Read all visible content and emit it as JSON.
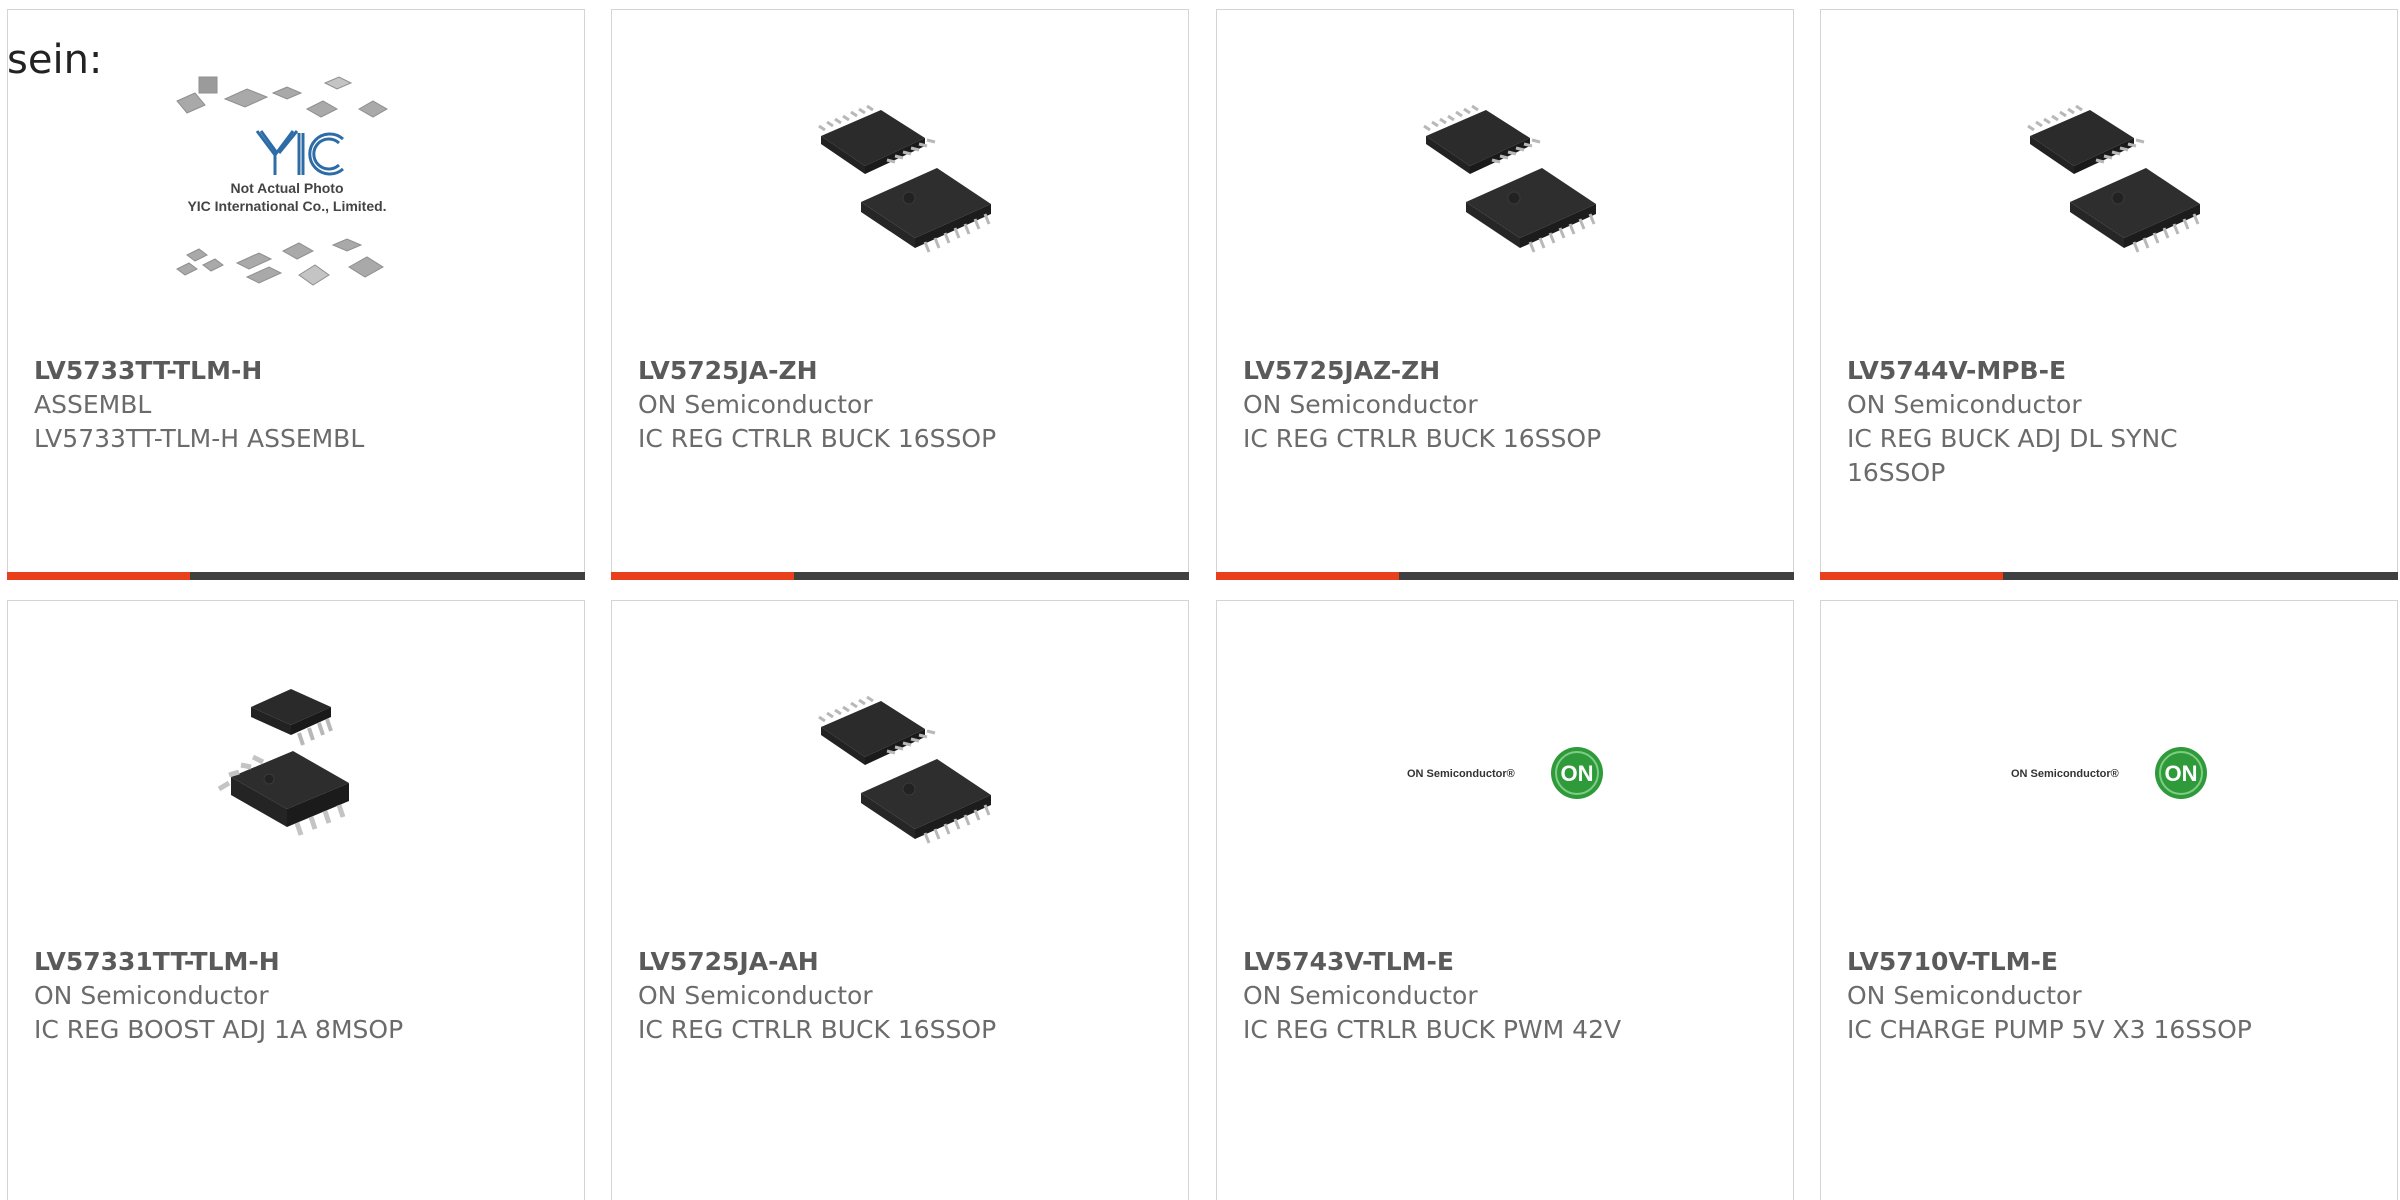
{
  "heading_fragment": "sein:",
  "colors": {
    "accent": "#e8401c",
    "bar": "#404040",
    "card_border": "#d4d4d4",
    "text": "#6b6b6b",
    "on_logo_green": "#2f9a3a"
  },
  "products": [
    {
      "part_number": "LV5733TT-TLM-H",
      "manufacturer": "ASSEMBL",
      "description": "LV5733TT-TLM-H ASSEMBL",
      "image": "placeholder-yic-photo",
      "placeholder_text": {
        "brand": "YIC",
        "line1": "Not Actual Photo",
        "line2": "YIC International Co., Limited."
      },
      "accent_bar": true
    },
    {
      "part_number": "LV5725JA-ZH",
      "manufacturer": "ON Semiconductor",
      "description": "IC REG CTRLR BUCK 16SSOP",
      "image": "ssop16-chip-photo",
      "accent_bar": true
    },
    {
      "part_number": "LV5725JAZ-ZH",
      "manufacturer": "ON Semiconductor",
      "description": "IC REG CTRLR BUCK 16SSOP",
      "image": "ssop16-chip-photo",
      "accent_bar": true
    },
    {
      "part_number": "LV5744V-MPB-E",
      "manufacturer": "ON Semiconductor",
      "description": "IC REG BUCK ADJ DL SYNC 16SSOP",
      "image": "ssop16-chip-photo",
      "accent_bar": true
    },
    {
      "part_number": "LV57331TT-TLM-H",
      "manufacturer": "ON Semiconductor",
      "description": "IC REG BOOST ADJ 1A 8MSOP",
      "image": "msop8-chip-photo",
      "accent_bar": false
    },
    {
      "part_number": "LV5725JA-AH",
      "manufacturer": "ON Semiconductor",
      "description": "IC REG CTRLR BUCK 16SSOP",
      "image": "ssop16-chip-photo",
      "accent_bar": false
    },
    {
      "part_number": "LV5743V-TLM-E",
      "manufacturer": "ON Semiconductor",
      "description": "IC REG CTRLR BUCK PWM 42V",
      "image": "on-semiconductor-logo",
      "logo_text": "ON Semiconductor®",
      "logo_badge": "ON",
      "accent_bar": false
    },
    {
      "part_number": "LV5710V-TLM-E",
      "manufacturer": "ON Semiconductor",
      "description": "IC CHARGE PUMP 5V X3 16SSOP",
      "image": "on-semiconductor-logo",
      "logo_text": "ON Semiconductor®",
      "logo_badge": "ON",
      "accent_bar": false
    }
  ]
}
